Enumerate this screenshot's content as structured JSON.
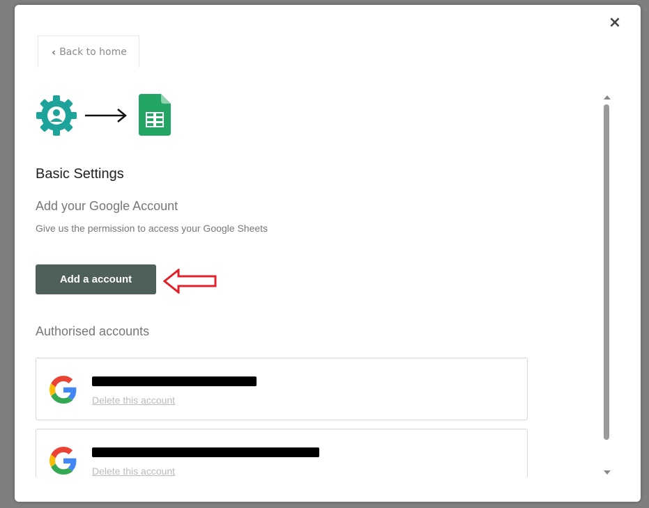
{
  "modal": {
    "close_label": "×",
    "back_label": "Back to home",
    "back_icon": "chevron-left-icon"
  },
  "integration": {
    "source_icon": "gear-user-icon",
    "arrow_icon": "right-arrow-icon",
    "target_icon": "google-sheets-icon",
    "accent_color": "#1ea39a",
    "sheets_color": "#23a566"
  },
  "settings": {
    "title": "Basic Settings",
    "subtitle": "Add your Google Account",
    "description": "Give us the permission to access your Google Sheets",
    "add_button_label": "Add a account",
    "add_button_color": "#4f5f5a"
  },
  "accounts": {
    "title": "Authorised accounts",
    "items": [
      {
        "email": "redacted-email-address-one",
        "delete_label": "Delete this account",
        "icon": "google-g-icon"
      },
      {
        "email": "redacted-email-address-number-two",
        "delete_label": "Delete this account",
        "icon": "google-g-icon"
      }
    ]
  }
}
